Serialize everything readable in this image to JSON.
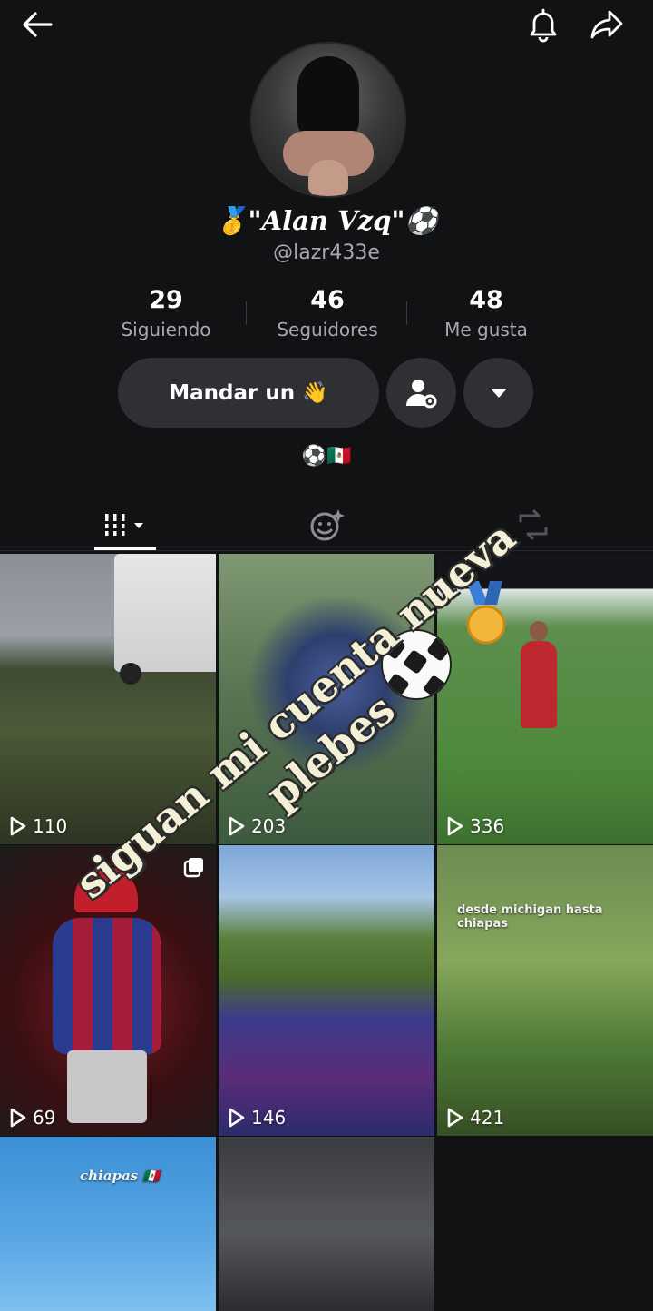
{
  "profile": {
    "display_name": "🥇\"Alan Vzq\"⚽",
    "username": "@lazr433e",
    "bio": "⚽🇲🇽"
  },
  "stats": [
    {
      "value": "29",
      "label": "Siguiendo"
    },
    {
      "value": "46",
      "label": "Seguidores"
    },
    {
      "value": "48",
      "label": "Me gusta"
    }
  ],
  "actions": {
    "wave_button": "Mandar un 👋"
  },
  "tabs": [
    "videos",
    "liked",
    "reposts"
  ],
  "videos": [
    {
      "views": "110"
    },
    {
      "views": "203"
    },
    {
      "views": "336"
    },
    {
      "views": "69"
    },
    {
      "views": "146"
    },
    {
      "views": "421",
      "caption": "desde michigan hasta chiapas"
    },
    {
      "caption": "chiapas 🇲🇽"
    },
    {}
  ],
  "overlay": {
    "line1": "siguan mi cuenta nueva",
    "line2": "plebes"
  },
  "colors": {
    "background": "#111214",
    "button": "#2f3034",
    "muted_text": "#a9a9ad"
  }
}
